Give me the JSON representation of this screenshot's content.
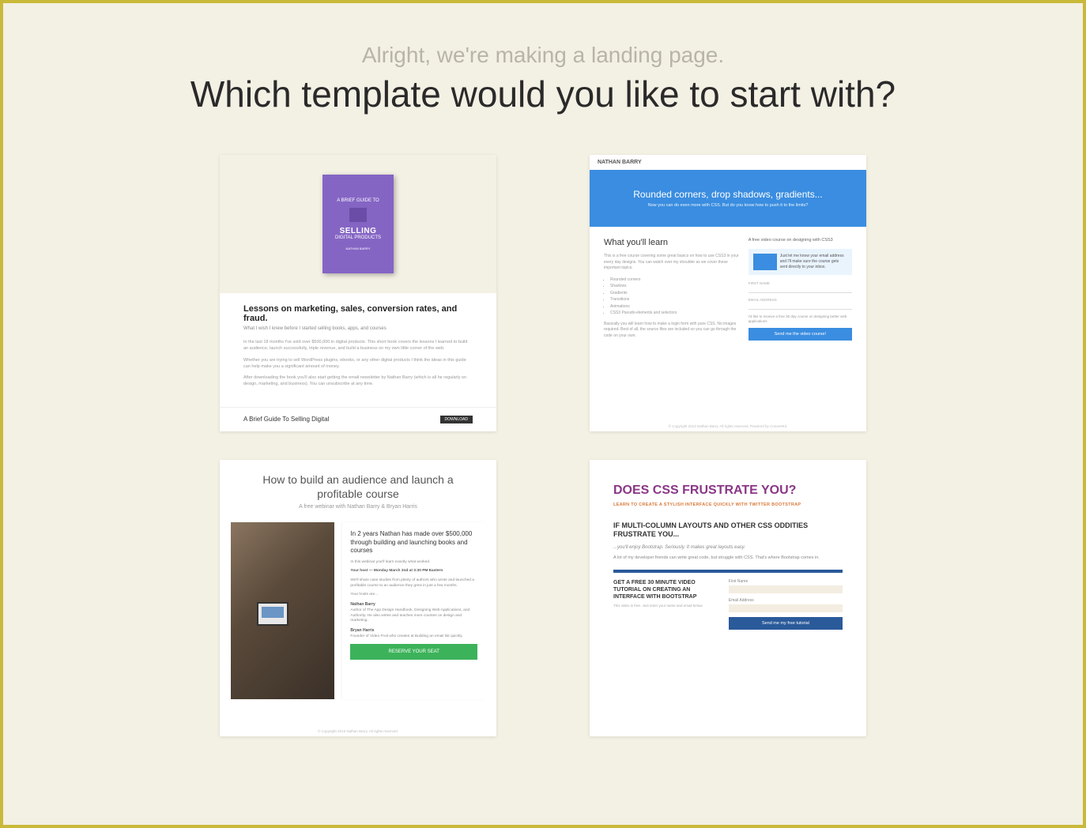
{
  "header": {
    "subtitle": "Alright, we're making a landing page.",
    "title": "Which template would you like to start with?"
  },
  "templates": [
    {
      "id": "ebook-purple",
      "book_pretitle": "A BRIEF GUIDE TO",
      "book_title": "SELLING",
      "book_subtitle": "DIGITAL PRODUCTS",
      "book_author": "NATHAN BARRY",
      "heading": "Lessons on marketing, sales, conversion rates, and fraud.",
      "subhead": "What I wish I knew before I started selling books, apps, and courses",
      "p1": "In the last 18 months I've sold over $500,000 in digital products. This short book covers the lessons I learned to build an audience, launch successfully, triple revenue, and build a business on my own little corner of the web.",
      "p2": "Whether you are trying to sell WordPress plugins, ebooks, or any other digital products I think the ideas in this guide can help make you a significant amount of money.",
      "p3": "After downloading the book you'll also start getting the email newsletter by Nathan Barry (which is all he regularly on design, marketing, and business). You can unsubscribe at any time.",
      "footer_title": "A Brief Guide To Selling Digital",
      "footer_btn": "DOWNLOAD"
    },
    {
      "id": "video-course-blue",
      "nav_brand": "NATHAN BARRY",
      "hero_h": "Rounded corners, drop shadows, gradients...",
      "hero_p": "Now you can do even more with CSS. But do you know how to push it to the limits?",
      "left_h": "What you'll learn",
      "left_p": "This is a free course covering some great basics on how to use CSS3 in your every day designs. You can watch over my shoulder as we cover these important topics.",
      "list": [
        "Rounded corners",
        "Shadows",
        "Gradients",
        "Transitions",
        "Animations",
        "CSS3 Pseudo-elements and selectors"
      ],
      "left_p2": "Basically you will learn how to make a login form with pure CSS. No images required. Best of all, the source files are included so you can go through the code on your own.",
      "side_h": "A free video course on designing with CSS3",
      "signup_text": "Just let me know your email address and I'll make sure the course gets sent directly to your inbox.",
      "field1": "FIRST NAME",
      "field2": "EMAIL ADDRESS",
      "checkbox_text": "I'd like to receive a free 30 day course on designing better web applications",
      "cta": "Send me the video course!",
      "footer": "© Copyright 2013 Nathan Barry. All rights reserved. Powered by ConvertKit."
    },
    {
      "id": "webinar-photo",
      "heading": "How to build an audience and launch a profitable course",
      "sub": "A free webinar with Nathan Barry & Bryan Harris",
      "content_h": "In 2 years Nathan has made over $500,000 through building and launching books and courses",
      "content_p1": "In this webinar you'll learn exactly what worked.",
      "content_p2": "Your host — Monday March 2nd at 3:30 PM Eastern",
      "content_p3": "We'll share case studies from plenty of authors who wrote and launched a profitable course to an audience they grew in just a few months.",
      "hosts_label": "Your hosts are...",
      "host1_name": "Nathan Barry",
      "host1_bio": "Author of The App Design Handbook, Designing Web Applications, and Authority. He also writes and teaches more courses on design and marketing.",
      "host2_name": "Bryan Harris",
      "host2_bio": "Founder of Video Fruit who creates at Building an email list quickly.",
      "btn": "RESERVE YOUR SEAT",
      "footer": "© Copyright 2015 Nathan Barry. All rights reserved."
    },
    {
      "id": "css-frustrate",
      "heading": "DOES CSS FRUSTRATE YOU?",
      "sub": "LEARN TO CREATE A STYLISH INTERFACE QUICKLY WITH TWITTER BOOTSTRAP",
      "h2": "IF MULTI-COLUMN LAYOUTS AND OTHER CSS ODDITIES FRUSTRATE YOU...",
      "p1": "...you'll enjoy Bootstrap. Seriously. It makes great layouts easy.",
      "p2": "A lot of my developer friends can write great code, but struggle with CSS. That's where Bootstrap comes in.",
      "form_h": "GET A FREE 30 MINUTE VIDEO TUTORIAL ON CREATING AN INTERFACE WITH BOOTSTRAP",
      "form_p": "This video is free. Just enter your name and email below.",
      "field1": "First Name",
      "field2": "Email Address",
      "btn": "Send me my free tutorial"
    }
  ]
}
